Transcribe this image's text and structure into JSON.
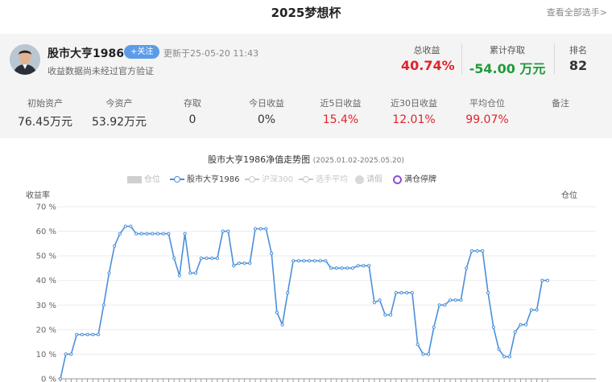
{
  "header": {
    "title": "2025梦想杯",
    "view_all": "查看全部选手>"
  },
  "player": {
    "name": "股市大亨1986",
    "follow_label": "+关注",
    "updated": "更新于25-05-20 11:43",
    "verify_note": "收益数据尚未经过官方验证",
    "total_return_label": "总收益",
    "total_return": "40.74%",
    "net_flow_label": "累计存取",
    "net_flow": "-54.00 万元",
    "rank_label": "排名",
    "rank": "82"
  },
  "stats": [
    {
      "label": "初始资产",
      "value": "76.45万元",
      "color": "normal"
    },
    {
      "label": "今资产",
      "value": "53.92万元",
      "color": "normal"
    },
    {
      "label": "存取",
      "value": "0",
      "color": "normal"
    },
    {
      "label": "今日收益",
      "value": "0%",
      "color": "normal"
    },
    {
      "label": "近5日收益",
      "value": "15.4%",
      "color": "red"
    },
    {
      "label": "近30日收益",
      "value": "12.01%",
      "color": "red"
    },
    {
      "label": "平均仓位",
      "value": "99.07%",
      "color": "red"
    },
    {
      "label": "备注",
      "value": "",
      "color": "normal"
    }
  ],
  "colors": {
    "series": "#4a90d9",
    "gain": "#e0232b",
    "loss": "#1f9b3a",
    "follow": "#5b9be8",
    "halt": "#8a4fd8"
  },
  "chart_data": {
    "type": "line",
    "title": "股市大亨1986净值走势图",
    "subtitle": "(2025.01.02-2025.05.20)",
    "ylabel": "收益率",
    "y2label": "仓位",
    "ylim": [
      0,
      70
    ],
    "yticks": [
      "0 %",
      "10 %",
      "20 %",
      "30 %",
      "40 %",
      "50 %",
      "60 %",
      "70 %"
    ],
    "grid": true,
    "legend": [
      {
        "name": "仓位",
        "mark": "bar",
        "active": false
      },
      {
        "name": "股市大亨1986",
        "mark": "line",
        "active": true
      },
      {
        "name": "沪深300",
        "mark": "line",
        "active": false
      },
      {
        "name": "选手平均",
        "mark": "line",
        "active": false
      },
      {
        "name": "请假",
        "mark": "dot",
        "active": false
      },
      {
        "name": "满仓停牌",
        "mark": "ring",
        "active": true
      }
    ],
    "series": [
      {
        "name": "股市大亨1986",
        "values": [
          0,
          10,
          10,
          18,
          18,
          18,
          18,
          18,
          30,
          43,
          54,
          59,
          62,
          62,
          59,
          59,
          59,
          59,
          59,
          59,
          59,
          49,
          42,
          59,
          43,
          43,
          49,
          49,
          49,
          49,
          60,
          60,
          46,
          47,
          47,
          47,
          61,
          61,
          61,
          51,
          27,
          22,
          35,
          48,
          48,
          48,
          48,
          48,
          48,
          48,
          45,
          45,
          45,
          45,
          45,
          46,
          46,
          46,
          31,
          32,
          26,
          26,
          35,
          35,
          35,
          35,
          14,
          10,
          10,
          21,
          30,
          30,
          32,
          32,
          32,
          45,
          52,
          52,
          52,
          35,
          21,
          12,
          9,
          9,
          19,
          22,
          22,
          28,
          28,
          40,
          40
        ]
      }
    ]
  }
}
